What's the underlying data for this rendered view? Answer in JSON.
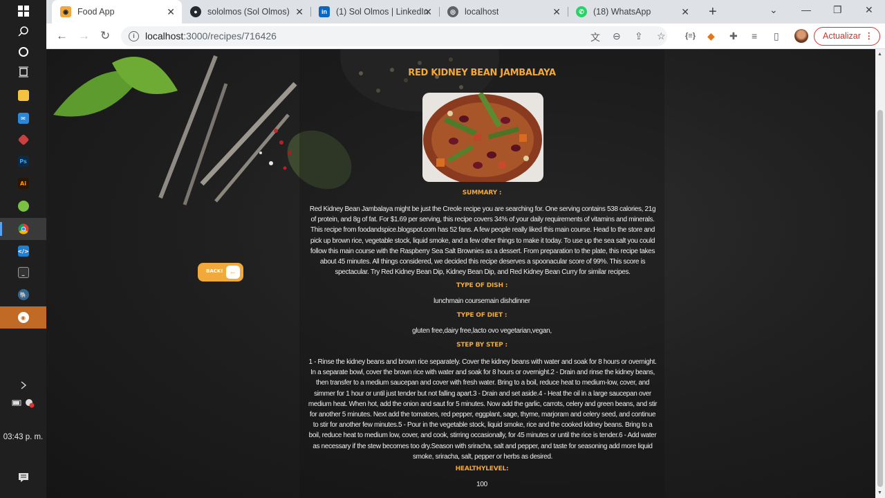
{
  "taskbar": {
    "clock": "03:43 p. m.",
    "apps": [
      "windows-logo",
      "search",
      "cortana",
      "task-view",
      "file-explorer",
      "mail",
      "app-red",
      "photoshop",
      "illustrator",
      "app-green",
      "chrome",
      "vscode",
      "terminal",
      "postgres",
      "app-orange"
    ]
  },
  "browser": {
    "tabs": [
      {
        "title": "Food App",
        "icon": "food-app-icon",
        "active": true
      },
      {
        "title": "sololmos (Sol Olmos)",
        "icon": "github-icon",
        "active": false
      },
      {
        "title": "(1) Sol Olmos | LinkedIn",
        "icon": "linkedin-icon",
        "active": false
      },
      {
        "title": "localhost",
        "icon": "globe-icon",
        "active": false
      },
      {
        "title": "(18) WhatsApp",
        "icon": "whatsapp-icon",
        "active": false
      }
    ],
    "url_host": "localhost",
    "url_path": ":3000/recipes/716426",
    "update_label": "Actualizar"
  },
  "recipe": {
    "title": "RED KIDNEY BEAN JAMBALAYA",
    "summary_label": "SUMMARY :",
    "summary": "Red Kidney Bean Jambalaya might be just the Creole recipe you are searching for. One serving contains 538 calories, 21g of protein, and 8g of fat. For $1.69 per serving, this recipe covers 34% of your daily requirements of vitamins and minerals. This recipe from foodandspice.blogspot.com has 52 fans. A few people really liked this main course. Head to the store and pick up brown rice, vegetable stock, liquid smoke, and a few other things to make it today. To use up the sea salt you could follow this main course with the Raspberry Sea Salt Brownies as a dessert. From preparation to the plate, this recipe takes about 45 minutes. All things considered, we decided this recipe deserves a spoonacular score of 99%. This score is spectacular. Try Red Kidney Bean Dip, Kidney Bean Dip, and Red Kidney Bean Curry for similar recipes.",
    "dish_label": "TYPE OF DISH :",
    "dish": "lunchmain coursemain dishdinner",
    "diet_label": "TYPE OF DIET :",
    "diet": "gluten free,dairy free,lacto ovo vegetarian,vegan,",
    "steps_label": "STEP BY STEP :",
    "steps": "1 - Rinse the kidney beans and brown rice separately. Cover the kidney beans with water and soak for 8 hours or overnight. In a separate bowl, cover the brown rice with water and soak for 8 hours or overnight.2 - Drain and rinse the kidney beans, then transfer to a medium saucepan and cover with fresh water. Bring to a boil, reduce heat to medium-low, cover, and simmer for 1 hour or until just tender but not falling apart.3 - Drain and set aside.4 - Heat the oil in a large saucepan over medium heat. When hot, add the onion and saut for 5 minutes. Now add the garlic, carrots, celery and green beans, and stir for another 5 minutes. Next add the tomatoes, red pepper, eggplant, sage, thyme, marjoram and celery seed, and continue to stir for another few minutes.5 - Pour in the vegetable stock, liquid smoke, rice and the cooked kidney beans. Bring to a boil, reduce heat to medium low, cover, and cook, stirring occasionally, for 45 minutes or until the rice is tender.6 - Add water as necessary if the stew becomes too dry.Season with sriracha, salt and pepper, and taste for seasoning add more liquid smoke, sriracha, salt, pepper or herbs as desired.",
    "health_label": "HEALTHYLEVEL:",
    "health": "100",
    "back_label": "BACK!"
  },
  "colors": {
    "accent": "#f2a93b",
    "page_bg": "#1b1b1b",
    "update_red": "#d93025"
  }
}
